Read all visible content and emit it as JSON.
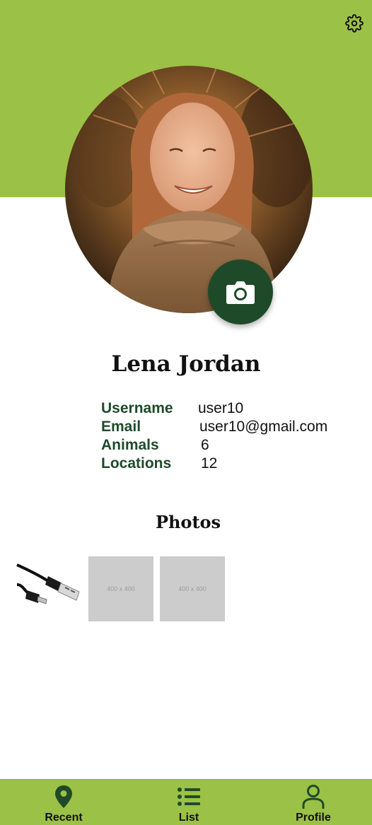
{
  "header": {
    "settings_icon": "gear-icon",
    "colors": {
      "accent": "#9bc146",
      "dark_green": "#1f4a2a"
    }
  },
  "profile": {
    "name": "Lena Jordan",
    "camera_icon": "camera-icon",
    "fields": [
      {
        "label": "Username",
        "value": "user10"
      },
      {
        "label": "Email",
        "value": "user10@gmail.com"
      },
      {
        "label": "Animals",
        "value": "6"
      },
      {
        "label": "Locations",
        "value": "12"
      }
    ]
  },
  "photos": {
    "heading": "Photos",
    "items": [
      {
        "kind": "usb-cable-image"
      },
      {
        "kind": "placeholder",
        "text": "400 x 400"
      },
      {
        "kind": "placeholder",
        "text": "400 x 400"
      }
    ]
  },
  "nav": {
    "items": [
      {
        "label": "Recent",
        "icon": "map-pin-icon"
      },
      {
        "label": "List",
        "icon": "list-icon"
      },
      {
        "label": "Profile",
        "icon": "person-icon"
      }
    ]
  }
}
